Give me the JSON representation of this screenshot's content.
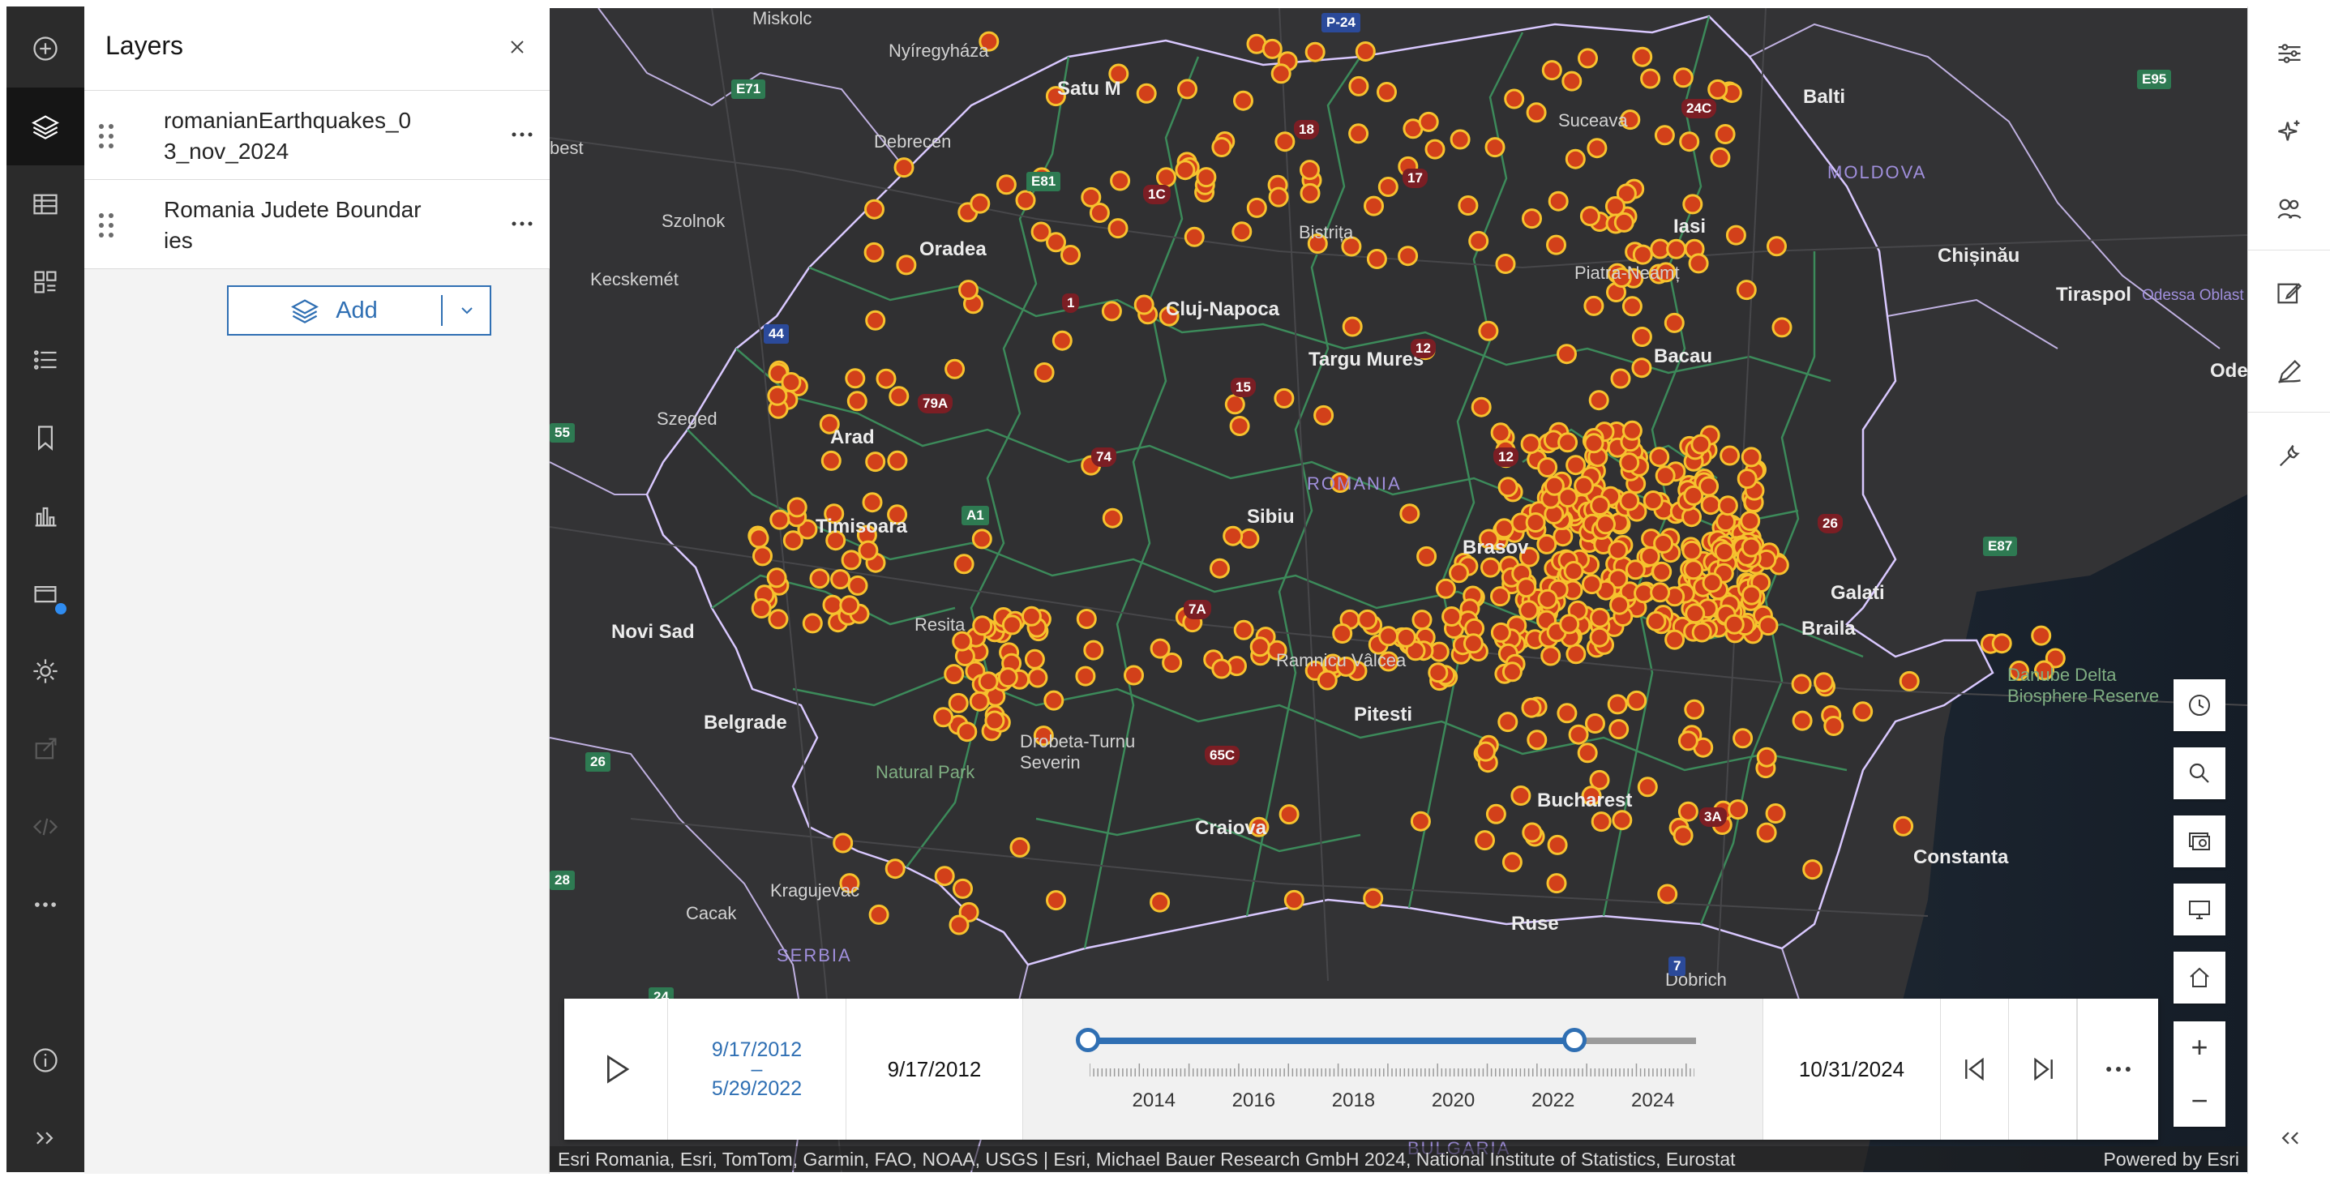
{
  "layers_panel": {
    "title": "Layers",
    "layers": [
      {
        "name": "romanianEarthquakes_03_nov_2024"
      },
      {
        "name": "Romania Judete Boundaries"
      }
    ],
    "add_label": "Add"
  },
  "left_toolbar": {
    "items": [
      "add-icon",
      "layers-icon",
      "table-icon",
      "legend-icon",
      "list-icon",
      "bookmark-icon",
      "chart-icon",
      "map-properties-icon",
      "settings-icon",
      "share-icon",
      "embed-icon",
      "more-icon",
      "info-icon",
      "expand-icon"
    ]
  },
  "right_toolbar": {
    "items": [
      "properties-icon",
      "effects-icon",
      "styles-icon",
      "pop-ups-icon",
      "sketch-icon",
      "configure-icon",
      "collapse-icon"
    ]
  },
  "map": {
    "labels": {
      "miskolc": "Miskolc",
      "nyiregyhaza": "Nyíregyháza",
      "debrecen": "Debrecen",
      "szolnok": "Szolnok",
      "kecskemet": "Kecskemét",
      "szeged": "Szeged",
      "oradea": "Oradea",
      "arad": "Arad",
      "timisoara": "Timisoara",
      "resita": "Resita",
      "novi_sad": "Novi Sad",
      "belgrade": "Belgrade",
      "kragujevac": "Kragujevac",
      "cacak": "Cacak",
      "serbia": "SERBIA",
      "drobeta": "Drobeta-Turnu\nSeverin",
      "craiova": "Craiova",
      "pitesti": "Pitesti",
      "ramnicu": "Ramnicu Vâlcea",
      "sibiu": "Sibiu",
      "romania": "ROMANIA",
      "brasov": "Brasov",
      "cluj": "Cluj-Napoca",
      "targu": "Targu Mures",
      "bistrita": "Bistrița",
      "satu": "Satu M",
      "suceava": "Suceava",
      "balti": "Balti",
      "moldova": "MOLDOVA",
      "iasi": "Iasi",
      "chisinau": "Chișinău",
      "tiraspol": "Tiraspol",
      "odessa": "Odessa Oblast",
      "ode": "Ode",
      "piatra": "Piatra-Neamț",
      "bacau": "Bacau",
      "galati": "Galati",
      "braila": "Braila",
      "danube": "Danube Delta\nBiosphere Reserve",
      "constanta": "Constanta",
      "bucharest": "Bucharest",
      "ruse": "Ruse",
      "dobrich": "Dobrich",
      "best": "best",
      "natural": "Natural Park",
      "bulgaria": "BULGARIA"
    },
    "shields": [
      "P-24",
      "E71",
      "E81",
      "44",
      "55",
      "26",
      "28",
      "24C",
      "18",
      "17",
      "1C",
      "1",
      "15",
      "12",
      "79A",
      "74",
      "A1",
      "7A",
      "65C",
      "12",
      "26",
      "E87",
      "3A",
      "7",
      "E95",
      "24"
    ]
  },
  "time_slider": {
    "range_start": "9/17/2012",
    "range_dash": "–",
    "range_end": "5/29/2022",
    "start_date": "9/17/2012",
    "end_date": "10/31/2024",
    "years": [
      "2014",
      "2016",
      "2018",
      "2020",
      "2022",
      "2024"
    ],
    "thumb_start_fraction": 0.0,
    "thumb_end_fraction": 0.8
  },
  "attribution": {
    "text": "Esri Romania, Esri, TomTom, Garmin, FAO, NOAA, USGS | Esri, Michael Bauer Research GmbH 2024, National Institute of Statistics, Eurostat",
    "powered": "Powered by Esri"
  },
  "colors": {
    "quake_fill": "#d2401a",
    "quake_stroke": "#f6c22e",
    "accent": "#2f6fb3",
    "boundary": "#3d8f5d"
  }
}
